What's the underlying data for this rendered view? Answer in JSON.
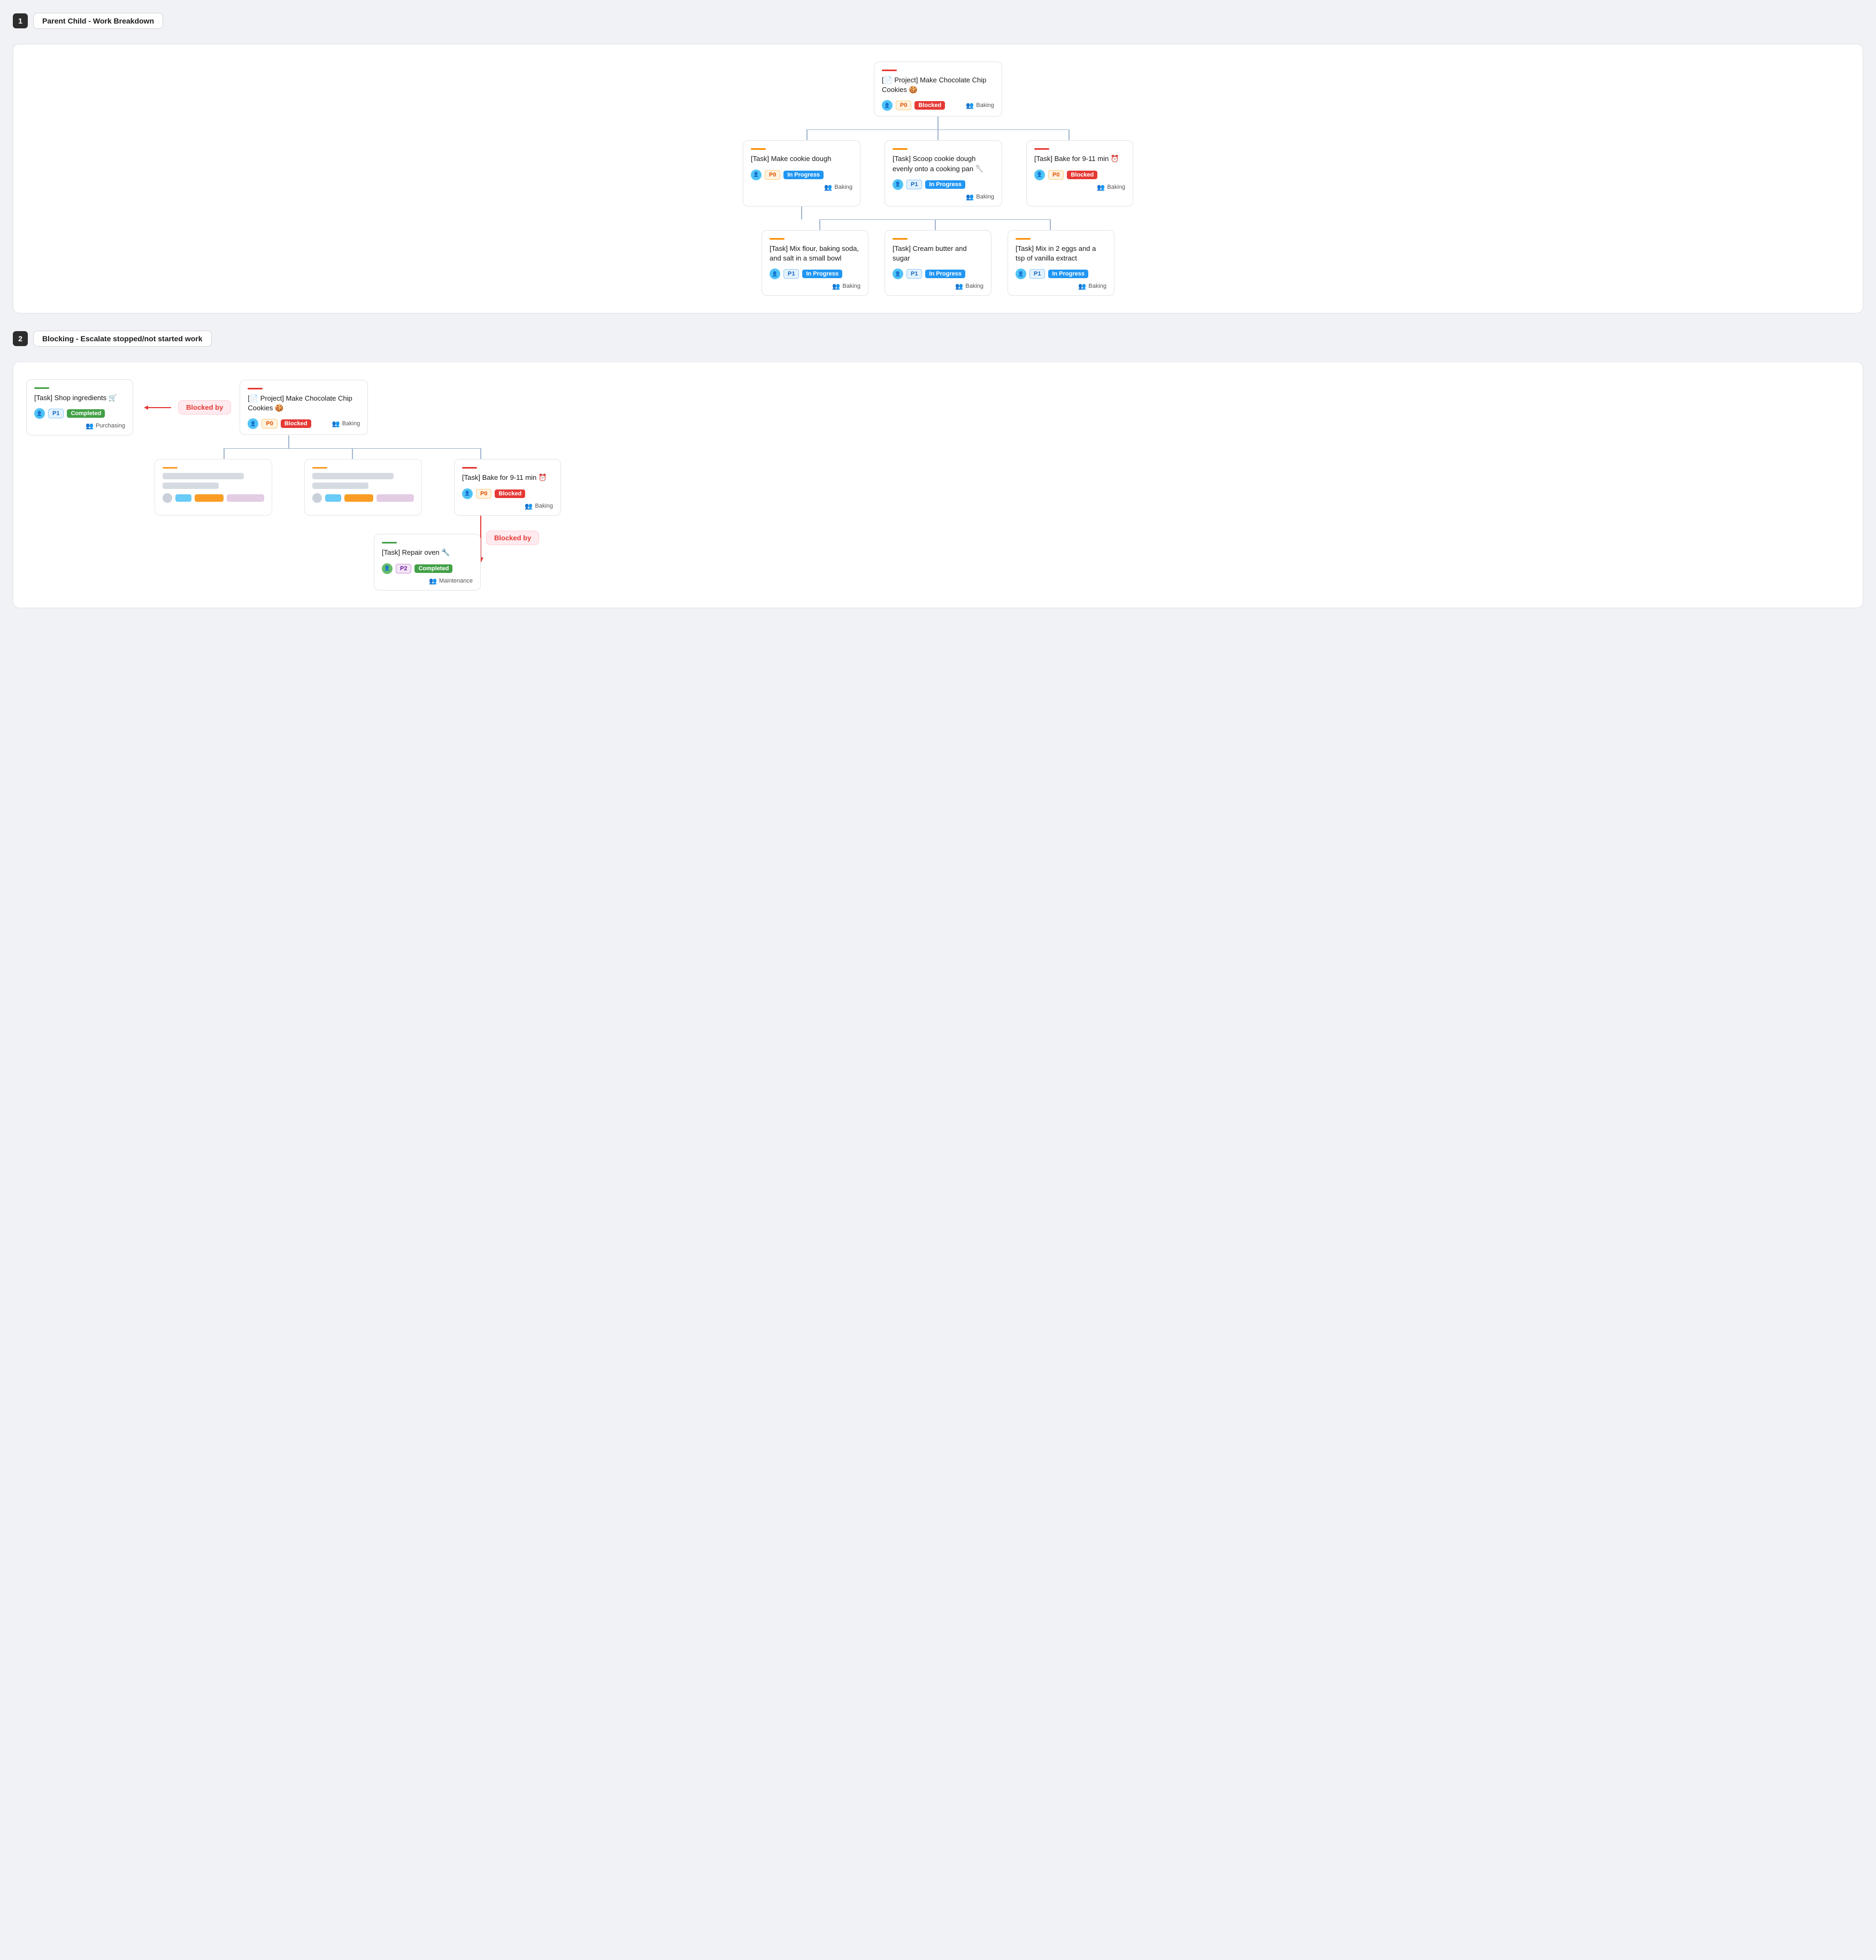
{
  "section1": {
    "number": "1",
    "title": "Parent Child - Work Breakdown",
    "root": {
      "accent": "accent-red",
      "icon": "📄",
      "title": "[📄 Project] Make Chocolate Chip Cookies 🍪",
      "avatar_color": "avatar-blue",
      "priority": "P0",
      "priority_class": "badge-p0",
      "status": "Blocked",
      "status_class": "badge-blocked",
      "team": "Baking"
    },
    "mid": [
      {
        "accent": "accent-orange",
        "title": "[Task] Make cookie dough",
        "avatar_color": "avatar-blue",
        "priority": "P0",
        "priority_class": "badge-p0",
        "status": "In Progress",
        "status_class": "badge-in-progress",
        "team": "Baking"
      },
      {
        "accent": "accent-orange",
        "title": "[Task] Scoop cookie dough evenly onto a cooking pan 🥄",
        "avatar_color": "avatar-blue",
        "priority": "P1",
        "priority_class": "badge-p1",
        "status": "In Progress",
        "status_class": "badge-in-progress",
        "team": "Baking"
      },
      {
        "accent": "accent-red",
        "title": "[Task] Bake for 9-11 min ⏰",
        "avatar_color": "avatar-blue",
        "priority": "P0",
        "priority_class": "badge-p0",
        "status": "Blocked",
        "status_class": "badge-blocked",
        "team": "Baking"
      }
    ],
    "bottom": [
      {
        "accent": "accent-orange",
        "title": "[Task] Mix flour, baking soda, and salt in a small bowl",
        "avatar_color": "avatar-blue",
        "priority": "P1",
        "priority_class": "badge-p1",
        "status": "In Progress",
        "status_class": "badge-in-progress",
        "team": "Baking"
      },
      {
        "accent": "accent-orange",
        "title": "[Task] Cream butter and sugar",
        "avatar_color": "avatar-blue",
        "priority": "P1",
        "priority_class": "badge-p1",
        "status": "In Progress",
        "status_class": "badge-in-progress",
        "team": "Baking"
      },
      {
        "accent": "accent-orange",
        "title": "[Task] Mix in 2 eggs and a tsp of vanilla extract",
        "avatar_color": "avatar-blue",
        "priority": "P1",
        "priority_class": "badge-p1",
        "status": "In Progress",
        "status_class": "badge-in-progress",
        "team": "Baking"
      }
    ]
  },
  "section2": {
    "number": "2",
    "title": "Blocking - Escalate stopped/not started work",
    "shop": {
      "accent": "accent-green",
      "title": "[Task] Shop ingredients 🛒",
      "avatar_color": "avatar-blue",
      "priority": "P1",
      "priority_class": "badge-p1",
      "status": "Completed",
      "status_class": "badge-completed",
      "team": "Purchasing"
    },
    "blocked_by_label": "Blocked by",
    "root": {
      "accent": "accent-red",
      "title": "[📄 Project] Make Chocolate Chip Cookies 🍪",
      "avatar_color": "avatar-blue",
      "priority": "P0",
      "priority_class": "badge-p0",
      "status": "Blocked",
      "status_class": "badge-blocked",
      "team": "Baking"
    },
    "bake": {
      "accent": "accent-red",
      "title": "[Task] Bake for 9-11 min ⏰",
      "avatar_color": "avatar-blue",
      "priority": "P0",
      "priority_class": "badge-p0",
      "status": "Blocked",
      "status_class": "badge-blocked",
      "team": "Baking"
    },
    "repair": {
      "accent": "accent-green",
      "title": "[Task] Repair oven 🔧",
      "avatar_color": "avatar-green",
      "priority": "P2",
      "priority_class": "badge-p2",
      "status": "Completed",
      "status_class": "badge-completed",
      "team": "Maintenance"
    },
    "blocked_by_label2": "Blocked by"
  }
}
